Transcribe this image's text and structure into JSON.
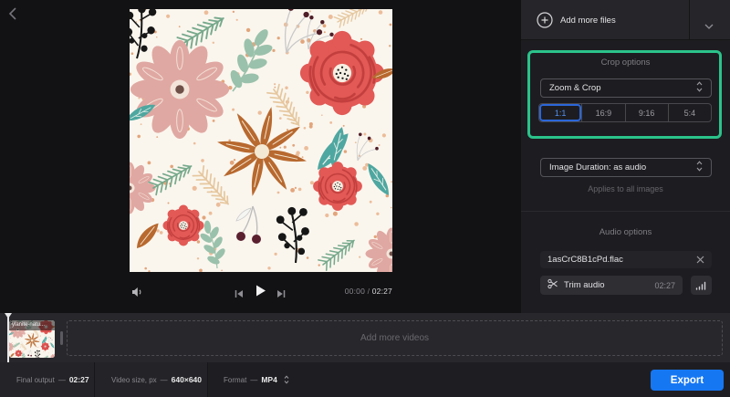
{
  "colors": {
    "accent_green": "#2bc38b",
    "accent_blue": "#1677f3",
    "ratio_selected": "#2b66d9"
  },
  "preview": {
    "time_current": "00:00",
    "time_separator": "/",
    "time_total": "02:27"
  },
  "panel": {
    "add_more_files": "Add more files",
    "crop_options_title": "Crop options",
    "crop_mode_value": "Zoom & Crop",
    "ratios": [
      "1:1",
      "16:9",
      "9:16",
      "5:4"
    ],
    "selected_ratio": "1:1",
    "image_duration_value": "Image Duration: as audio",
    "applies_note": "Applies to all images",
    "audio_options_title": "Audio options",
    "audio_filename": "1asCrC8B1cPd.flac",
    "trim_audio_label": "Trim audio",
    "trim_audio_time": "02:27"
  },
  "timeline": {
    "thumbnail_label": "ylanite-natu...",
    "add_more_videos": "Add more videos"
  },
  "footer": {
    "final_output_label": "Final output",
    "final_output_value": "02:27",
    "separator": "—",
    "video_size_label": "Video size, px",
    "video_size_value": "640×640",
    "format_label": "Format",
    "format_value": "MP4",
    "export_label": "Export"
  }
}
